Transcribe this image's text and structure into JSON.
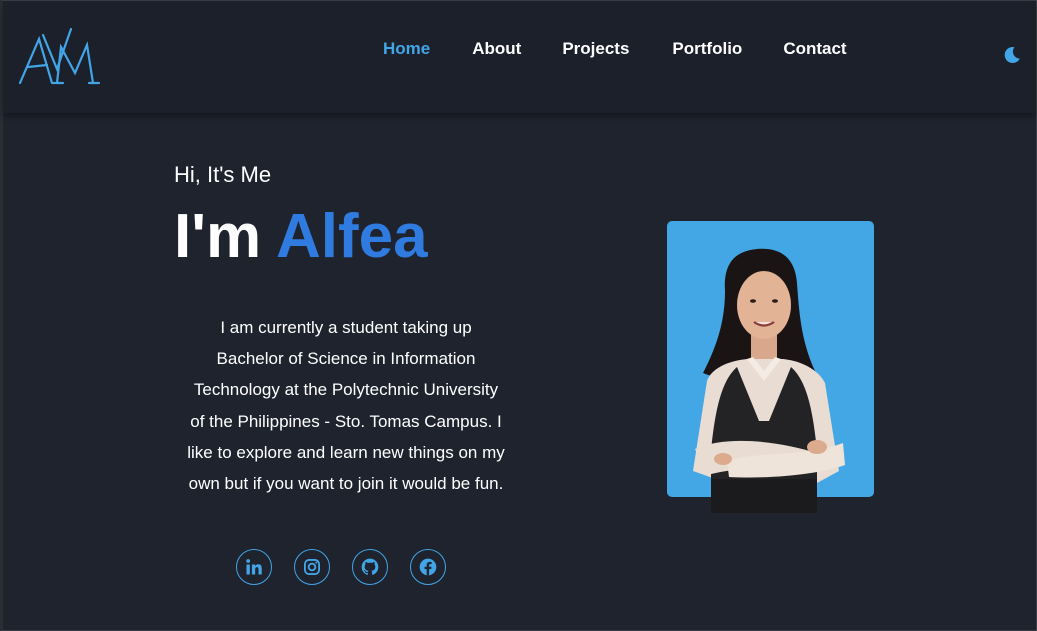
{
  "nav": {
    "logo_text": "AVM",
    "links": [
      "Home",
      "About",
      "Projects",
      "Portfolio",
      "Contact"
    ],
    "active": "Home",
    "theme_icon": "moon-icon"
  },
  "hero": {
    "greeting": "Hi, It's Me",
    "name_prefix": "I'm ",
    "name": "Alfea",
    "bio": "I am currently a student taking up Bachelor of Science in Information Technology at the Polytechnic University of the Philippines - Sto. Tomas Campus. I like to explore and learn new things on my own but if you want to join it would be fun.",
    "socials": [
      "linkedin-icon",
      "instagram-icon",
      "github-icon",
      "facebook-icon"
    ]
  },
  "colors": {
    "background": "#1e232d",
    "navbar": "#1b202a",
    "accent_blue": "#42a5e8",
    "name_blue": "#2f7be0",
    "photo_bg": "#43a7e6",
    "text": "#ffffff"
  }
}
